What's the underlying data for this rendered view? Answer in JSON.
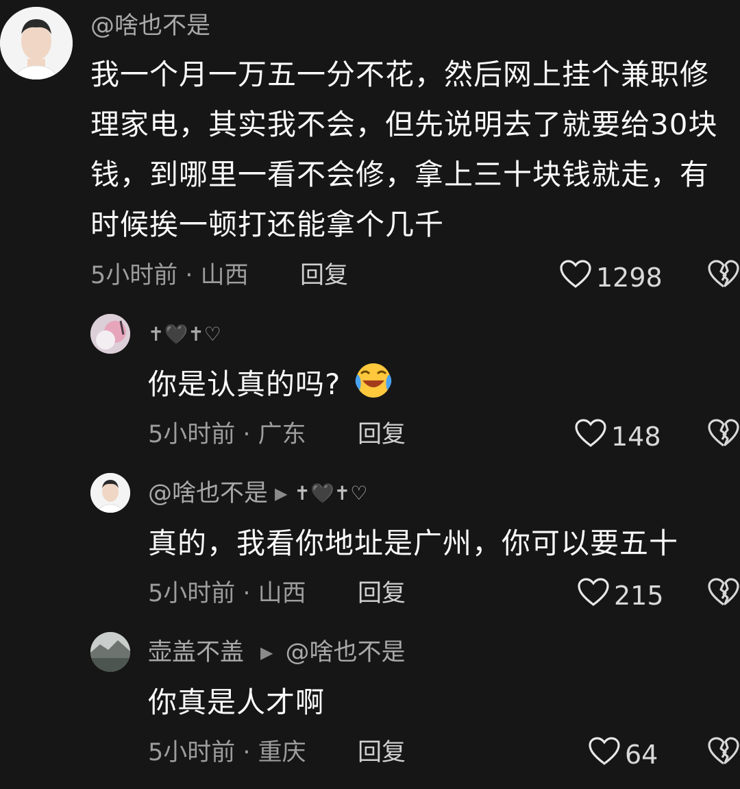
{
  "comments": [
    {
      "username": "@啥也不是",
      "text": "我一个月一万五一分不花，然后网上挂个兼职修理家电，其实我不会，但先说明去了就要给30块钱，到哪里一看不会修，拿上三十块钱就走，有时候挨一顿打还能拿个几千",
      "time_location": "5小时前 · 山西",
      "reply_label": "回复",
      "likes": "1298"
    },
    {
      "username": "✝︎🖤✝︎♡",
      "text": "你是认真的吗?",
      "emoji": "crying-laughing-emoji",
      "time_location": "5小时前 · 广东",
      "reply_label": "回复",
      "likes": "148"
    },
    {
      "username": "@啥也不是",
      "reply_to": "✝︎🖤✝︎♡",
      "text": "真的，我看你地址是广州，你可以要五十",
      "time_location": "5小时前 · 山西",
      "reply_label": "回复",
      "likes": "215"
    },
    {
      "username": "壶盖不盖",
      "reply_to": "@啥也不是",
      "text": "你真是人才啊",
      "time_location": "5小时前 · 重庆",
      "reply_label": "回复",
      "likes": "64"
    }
  ],
  "icons": {
    "like": "heart-outline-icon",
    "dislike": "broken-heart-icon",
    "reply_arrow": "play-triangle-icon"
  },
  "colors": {
    "background": "#161616",
    "text": "#fafafa",
    "secondary": "#9d9d9d"
  }
}
